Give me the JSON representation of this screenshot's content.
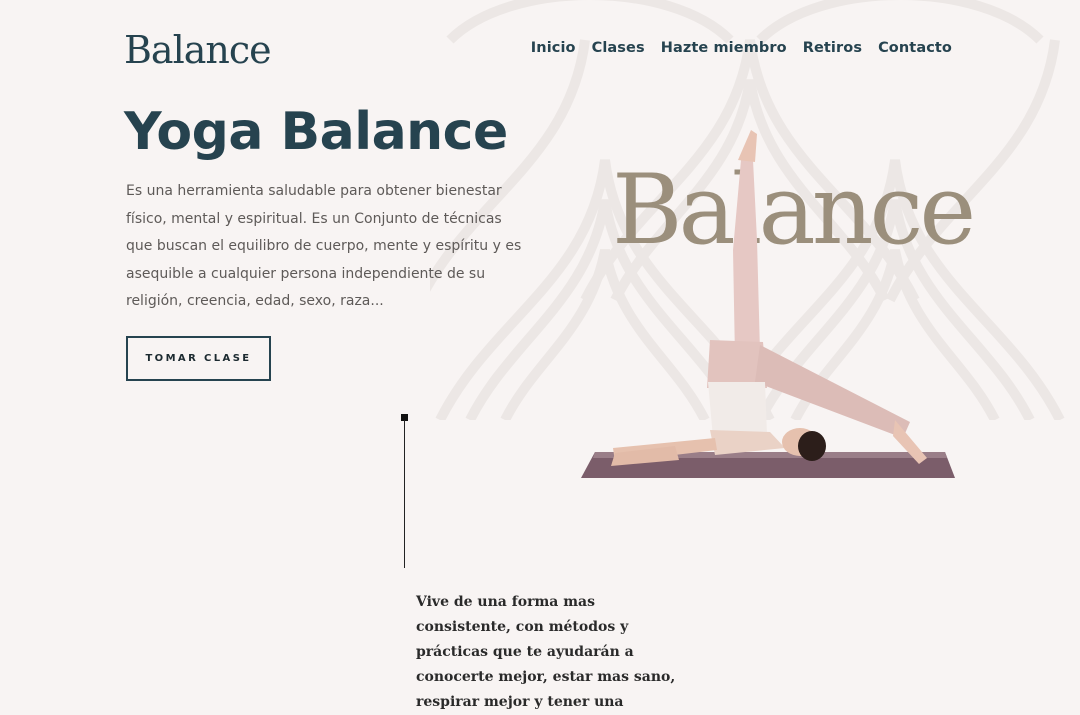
{
  "brand": {
    "logo": "Balance"
  },
  "nav": {
    "items": [
      "Inicio",
      "Clases",
      "Hazte miembro",
      "Retiros",
      "Contacto"
    ]
  },
  "hero": {
    "title": "Yoga Balance",
    "description": "Es una herramienta saludable para obtener bienestar físico, mental y espiritual. Es un Conjunto de técnicas que buscan el equilibro de cuerpo, mente y espíritu y es asequible a cualquier persona independiente de su religión, creencia, edad, sexo, raza...",
    "cta": "TOMAR CLASE",
    "image_word": "Balance"
  },
  "section": {
    "text": "Vive de una forma mas consistente, con métodos y prácticas que te ayudarán a conocerte mejor, estar mas sano, respirar mejor y tener una"
  },
  "colors": {
    "primary": "#26434f",
    "gold": "#9b8f7c",
    "background": "#f8f4f3"
  }
}
